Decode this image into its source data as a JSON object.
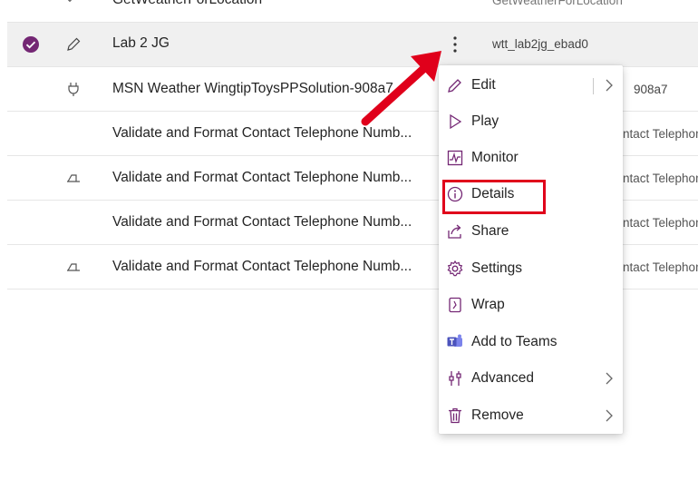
{
  "list": {
    "rows": [
      {
        "name": "GetWeatherForLocation",
        "sub": "GetWeatherForLocation",
        "icon": "flow-icon",
        "selected": false
      },
      {
        "name": "Lab 2 JG",
        "sub": "wtt_lab2jg_ebad0",
        "icon": "pen-icon",
        "selected": true
      },
      {
        "name": "MSN Weather WingtipToysPPSolution-908a7",
        "sub": "908a7",
        "icon": "plug-icon",
        "selected": false
      },
      {
        "name": "Validate and Format Contact Telephone Numb...",
        "sub": "ntact Telephon",
        "icon": "",
        "selected": false
      },
      {
        "name": "Validate and Format Contact Telephone Numb...",
        "sub": "ntact Telephon",
        "icon": "eraser-icon",
        "selected": false
      },
      {
        "name": "Validate and Format Contact Telephone Numb...",
        "sub": "ntact Telephon",
        "icon": "",
        "selected": false
      },
      {
        "name": "Validate and Format Contact Telephone Numb...",
        "sub": "ntact Telephon",
        "icon": "eraser-icon",
        "selected": false
      }
    ]
  },
  "menu": {
    "items": [
      {
        "label": "Edit",
        "icon": "edit-pen-icon",
        "has_submenu": true
      },
      {
        "label": "Play",
        "icon": "play-icon",
        "has_submenu": false
      },
      {
        "label": "Monitor",
        "icon": "monitor-icon",
        "has_submenu": false
      },
      {
        "label": "Details",
        "icon": "info-icon",
        "has_submenu": false
      },
      {
        "label": "Share",
        "icon": "share-icon",
        "has_submenu": false
      },
      {
        "label": "Settings",
        "icon": "gear-icon",
        "has_submenu": false
      },
      {
        "label": "Wrap",
        "icon": "wrap-icon",
        "has_submenu": false
      },
      {
        "label": "Add to Teams",
        "icon": "teams-icon",
        "has_submenu": false
      },
      {
        "label": "Advanced",
        "icon": "advanced-icon",
        "has_submenu": true
      },
      {
        "label": "Remove",
        "icon": "trash-icon",
        "has_submenu": true
      }
    ]
  },
  "colors": {
    "accent": "#742774",
    "highlight": "#e0001b",
    "text": "#242424",
    "selected_row": "#f0f0f0"
  }
}
